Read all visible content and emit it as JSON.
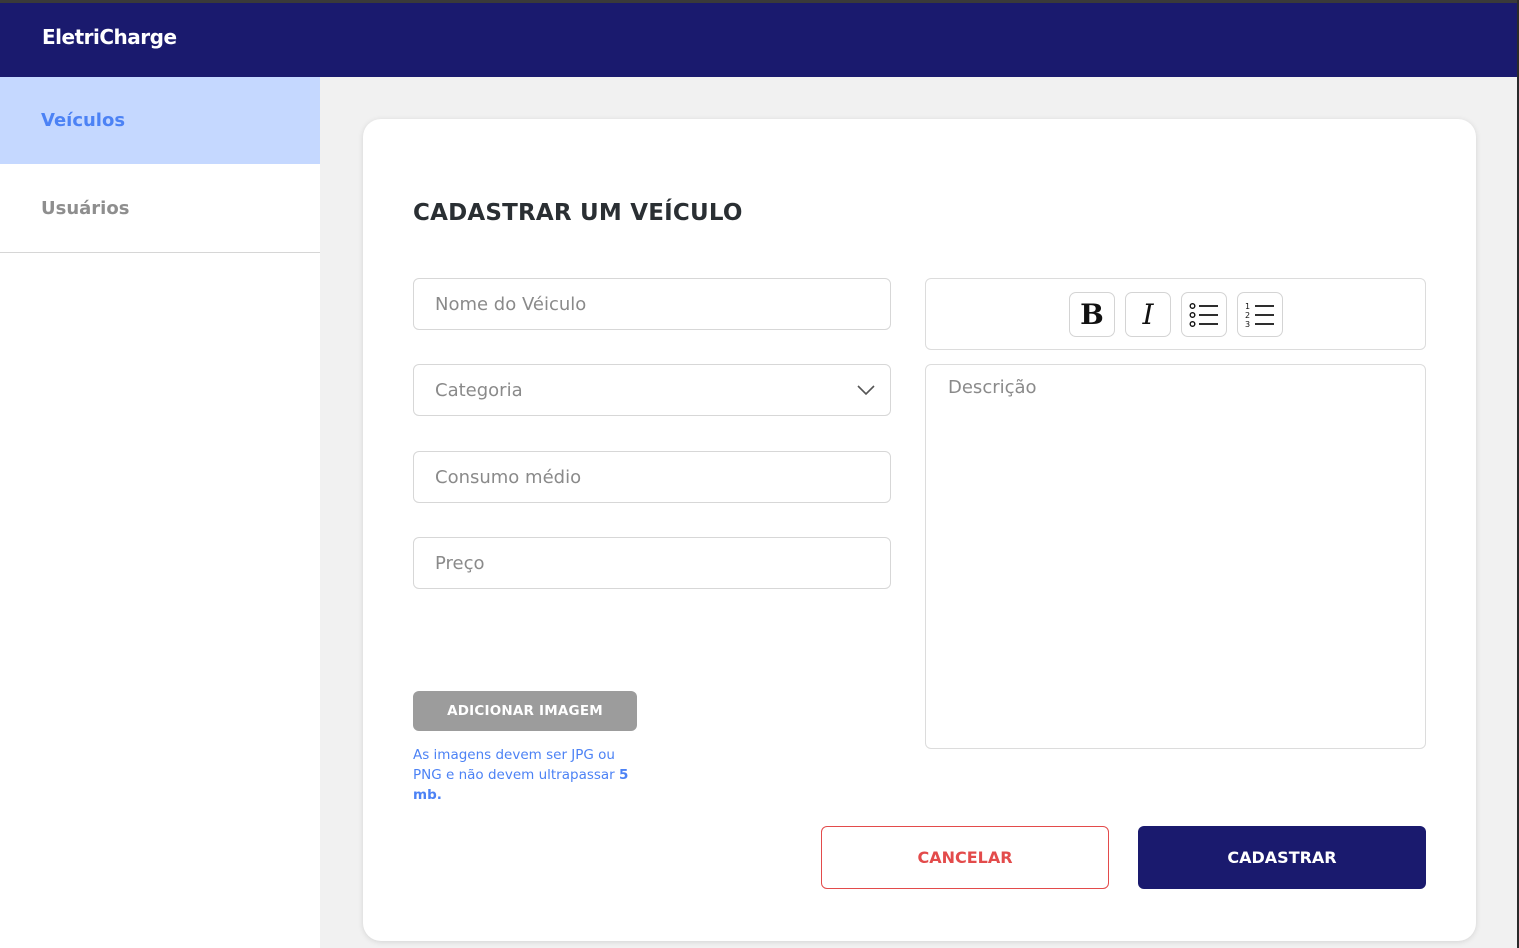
{
  "app": {
    "brand": "EletriCharge"
  },
  "sidebar": {
    "items": [
      {
        "label": "Veículos",
        "active": true
      },
      {
        "label": "Usuários",
        "active": false
      }
    ]
  },
  "form": {
    "title": "CADASTRAR UM VEÍCULO",
    "fields": {
      "nome": {
        "placeholder": "Nome do Véiculo",
        "value": ""
      },
      "categoria": {
        "placeholder": "Categoria",
        "value": ""
      },
      "consumo": {
        "placeholder": "Consumo médio",
        "value": ""
      },
      "preco": {
        "placeholder": "Preço",
        "value": ""
      },
      "descricao": {
        "placeholder": "Descrição",
        "value": ""
      }
    },
    "toolbar": {
      "bold_label": "B",
      "italic_label": "I",
      "icons": [
        "bold-icon",
        "italic-icon",
        "bulleted-list-icon",
        "numbered-list-icon"
      ]
    },
    "image": {
      "button_label": "ADICIONAR IMAGEM",
      "note_text": "As imagens devem ser  JPG ou PNG e não devem ultrapassar ",
      "note_limit": "5 mb."
    },
    "actions": {
      "cancel_label": "CANCELAR",
      "submit_label": "CADASTRAR"
    }
  },
  "colors": {
    "header": "#1a1a6e",
    "accent": "#4c82f5",
    "sidebar_active_bg": "#c5d8ff",
    "cancel": "#e34b4b",
    "disabled_button": "#9c9c9c"
  }
}
